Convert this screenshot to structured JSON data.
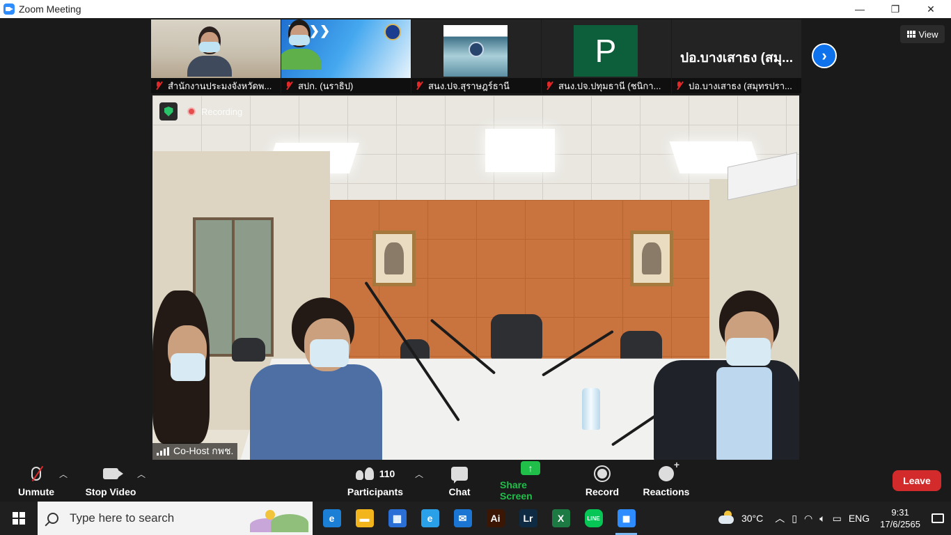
{
  "window": {
    "title": "Zoom Meeting",
    "controls": {
      "minimize": "—",
      "maximize": "❐",
      "close": "✕"
    }
  },
  "thumbnails": [
    {
      "name": "สำนักงานประมงจังหวัดพ...",
      "muted": true,
      "kind": "video"
    },
    {
      "name": "สปก. (นราธิป)",
      "muted": true,
      "kind": "video"
    },
    {
      "name": "สนง.ปจ.สุราษฎร์ธานี",
      "muted": true,
      "kind": "image"
    },
    {
      "name": "สนง.ปจ.ปทุมธานี (ชนิกา...",
      "muted": true,
      "kind": "initial",
      "initial": "P",
      "tile_color": "#0d5e3a"
    },
    {
      "name": "ปอ.บางเสาธง (สมุทรปรา...",
      "muted": true,
      "kind": "name",
      "display_name": "ปอ.บางเสาธง (สมุ..."
    }
  ],
  "view_button": {
    "label": "View"
  },
  "main_video": {
    "recording_label": "Recording",
    "speaker_name": "Co-Host กพช."
  },
  "toolbar": {
    "unmute": "Unmute",
    "stop_video": "Stop Video",
    "participants": "Participants",
    "participants_count": "110",
    "chat": "Chat",
    "share_screen": "Share Screen",
    "record": "Record",
    "reactions": "Reactions",
    "leave": "Leave"
  },
  "colors": {
    "accent_blue": "#0e72ed",
    "share_green": "#1fbf4a",
    "leave_red": "#d32b2b",
    "muted_red": "#e02828"
  },
  "taskbar": {
    "search_placeholder": "Type here to search",
    "apps": [
      {
        "name": "edge-icon",
        "label": "e",
        "color": "#1b7fd6"
      },
      {
        "name": "file-explorer-icon",
        "label": "▬",
        "color": "#f2b51c"
      },
      {
        "name": "store-icon",
        "label": "▦",
        "color": "#2a6fd6"
      },
      {
        "name": "internet-explorer-icon",
        "label": "e",
        "color": "#2aa0e8"
      },
      {
        "name": "mail-icon",
        "label": "✉",
        "color": "#1a76d2"
      },
      {
        "name": "illustrator-icon",
        "label": "Ai",
        "color": "#3b1605"
      },
      {
        "name": "lightroom-icon",
        "label": "Lr",
        "color": "#0f2b44"
      },
      {
        "name": "excel-icon",
        "label": "X",
        "color": "#1d7a43"
      },
      {
        "name": "line-icon",
        "label": "LINE",
        "color": "#06c755"
      },
      {
        "name": "zoom-icon",
        "label": "◼",
        "color": "#2d8cff"
      }
    ],
    "tray": {
      "temperature": "30°C",
      "language": "ENG",
      "time": "9:31",
      "date": "17/6/2565"
    }
  }
}
